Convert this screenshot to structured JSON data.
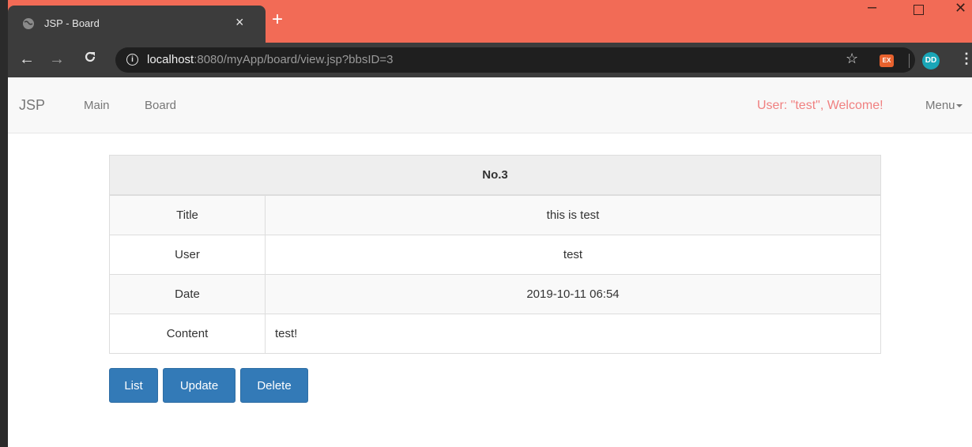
{
  "browser": {
    "tab_title": "JSP - Board",
    "tab_close": "×",
    "new_tab": "+",
    "url_host": "localhost",
    "url_rest": ":8080/myApp/board/view.jsp?bbsID=3",
    "info_glyph": "i",
    "extension_label": "EX",
    "avatar_initials": "DD",
    "window_min": "–",
    "window_close": "✕",
    "icons": [
      "globe-icon",
      "close-icon",
      "plus-icon",
      "back-arrow-icon",
      "forward-arrow-icon",
      "reload-icon",
      "info-icon",
      "star-icon",
      "extension-icon",
      "avatar",
      "menu-dots-icon"
    ]
  },
  "navbar": {
    "brand": "JSP",
    "links": [
      "Main",
      "Board"
    ],
    "welcome": "User: \"test\", Welcome!",
    "menu": "Menu"
  },
  "post": {
    "header": "No.3",
    "rows": [
      {
        "label": "Title",
        "value": "this is test"
      },
      {
        "label": "User",
        "value": "test"
      },
      {
        "label": "Date",
        "value": "2019-10-11 06:54"
      },
      {
        "label": "Content",
        "value": "test!"
      }
    ]
  },
  "actions": {
    "list": "List",
    "update": "Update",
    "delete": "Delete"
  },
  "colors": {
    "titlebar": "#f26b56",
    "primary_button": "#337ab7",
    "welcome_text": "#f08080"
  }
}
